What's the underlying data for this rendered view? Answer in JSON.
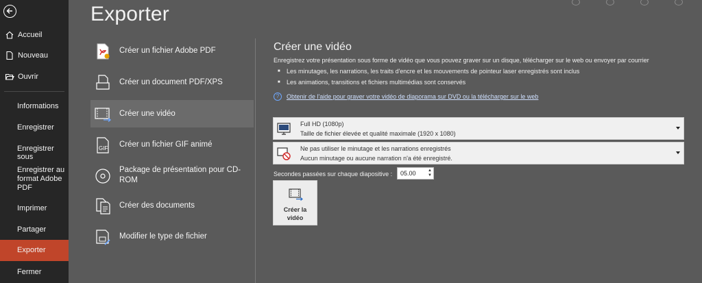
{
  "page_title": "Exporter",
  "nav": {
    "items": [
      {
        "label": "Accueil",
        "icon": "home-icon"
      },
      {
        "label": "Nouveau",
        "icon": "new-file-icon"
      },
      {
        "label": "Ouvrir",
        "icon": "folder-open-icon"
      },
      {
        "label": "Informations"
      },
      {
        "label": "Enregistrer"
      },
      {
        "label": "Enregistrer sous"
      },
      {
        "label": "Enregistrer au format Adobe PDF"
      },
      {
        "label": "Imprimer"
      },
      {
        "label": "Partager"
      },
      {
        "label": "Exporter",
        "active": true
      },
      {
        "label": "Fermer"
      }
    ]
  },
  "options": [
    {
      "label": "Créer un fichier Adobe PDF",
      "icon": "adobe-pdf-icon"
    },
    {
      "label": "Créer un document PDF/XPS",
      "icon": "pdf-xps-icon"
    },
    {
      "label": "Créer une vidéo",
      "icon": "video-icon",
      "selected": true
    },
    {
      "label": "Créer un fichier GIF animé",
      "icon": "gif-icon"
    },
    {
      "label": "Package de présentation pour CD-ROM",
      "icon": "cd-icon"
    },
    {
      "label": "Créer des documents",
      "icon": "documents-icon"
    },
    {
      "label": "Modifier le type de fichier",
      "icon": "change-filetype-icon"
    }
  ],
  "detail": {
    "title": "Créer une vidéo",
    "description": "Enregistrez votre présentation sous forme de vidéo que vous pouvez graver sur un disque, télécharger sur le web ou envoyer par courrier",
    "bullets": [
      "Les minutages, les narrations, les traits d'encre et les mouvements de pointeur laser enregistrés sont inclus",
      "Les animations, transitions et fichiers multimédias sont conservés"
    ],
    "help_link": "Obtenir de l'aide pour graver votre vidéo de diaporama sur DVD ou la télécharger sur le web",
    "quality": {
      "line1": "Full HD (1080p)",
      "line2": "Taille de fichier élevée et qualité maximale (1920 x 1080)"
    },
    "timing": {
      "line1": "Ne pas utiliser le minutage et les narrations enregistrés",
      "line2": "Aucun minutage ou aucune narration n'a été enregistré."
    },
    "seconds_label": "Secondes passées sur chaque diapositive :",
    "seconds_value": "05.00",
    "create_button": {
      "line1": "Créer la",
      "line2": "vidéo"
    }
  },
  "colors": {
    "nav_bg": "#262626",
    "main_bg": "#5a5a5a",
    "active": "#c0452a",
    "selected_option": "#6b6b6b"
  }
}
